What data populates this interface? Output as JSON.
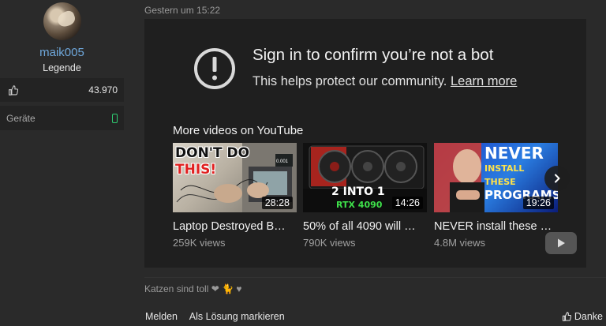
{
  "user": {
    "name": "maik005",
    "role": "Legende",
    "likes": "43.970",
    "devices_label": "Geräte"
  },
  "post": {
    "date": "Gestern um 15:22"
  },
  "embed": {
    "title": "Sign in to confirm you’re not a bot",
    "subtitle": "This helps protect our community.",
    "learn_more": "Learn more",
    "more_videos": "More videos on YouTube",
    "videos": [
      {
        "title": "Laptop Destroyed B…",
        "views": "259K views",
        "duration": "28:28",
        "thumb_text": "DON'T DO THIS!"
      },
      {
        "title": "50% of all 4090 will …",
        "views": "790K views",
        "duration": "14:26",
        "thumb_text": "2 INTO 1 RTX 4090"
      },
      {
        "title": "NEVER install these …",
        "views": "4.8M views",
        "duration": "19:26",
        "thumb_text": "NEVER INSTALL THESE PROGRAMS"
      }
    ]
  },
  "signature": {
    "text": "Katzen sind toll ❤ 🐈 ♥"
  },
  "actions": {
    "report": "Melden",
    "mark_solution": "Als Lösung markieren",
    "thanks": "Danke"
  },
  "colors": {
    "username": "#6fa8dc",
    "device_icon": "#2ecc71"
  }
}
